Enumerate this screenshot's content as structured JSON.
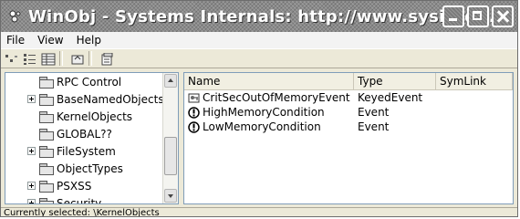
{
  "window": {
    "title": "WinObj - Systems Internals: http://www.sysinte..."
  },
  "menu": [
    {
      "label": "File"
    },
    {
      "label": "View"
    },
    {
      "label": "Help"
    }
  ],
  "toolbar": {
    "icons": [
      "list-small-icon",
      "list-view-icon",
      "details-view-icon",
      "up-folder-icon",
      "properties-icon"
    ]
  },
  "tree": {
    "items": [
      {
        "label": "RPC Control",
        "expandable": false
      },
      {
        "label": "BaseNamedObjects",
        "expandable": true
      },
      {
        "label": "KernelObjects",
        "expandable": false
      },
      {
        "label": "GLOBAL??",
        "expandable": false
      },
      {
        "label": "FileSystem",
        "expandable": true
      },
      {
        "label": "ObjectTypes",
        "expandable": false
      },
      {
        "label": "PSXSS",
        "expandable": true
      },
      {
        "label": "Security",
        "expandable": true
      }
    ]
  },
  "list": {
    "columns": [
      "Name",
      "Type",
      "SymLink"
    ],
    "rows": [
      {
        "name": "CritSecOutOfMemoryEvent",
        "type": "KeyedEvent",
        "icon": "keyed-event-icon"
      },
      {
        "name": "HighMemoryCondition",
        "type": "Event",
        "icon": "event-icon"
      },
      {
        "name": "LowMemoryCondition",
        "type": "Event",
        "icon": "event-icon"
      }
    ]
  },
  "status": {
    "text": "Currently selected:  \\KernelObjects"
  }
}
